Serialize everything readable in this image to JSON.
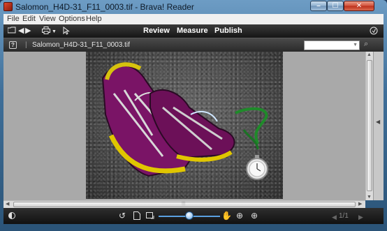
{
  "window": {
    "title": "Salomon_H4D-31_F11_0003.tif - Brava! Reader",
    "controls": {
      "minimize": "–",
      "maximize": "☐",
      "close": "✕"
    }
  },
  "menubar": {
    "items": [
      "File",
      "Edit",
      "View",
      "Options",
      "Help"
    ]
  },
  "toolbar": {
    "menus": [
      "Review",
      "Measure",
      "Publish"
    ],
    "icons": [
      "folder-icon",
      "back-icon",
      "forward-icon",
      "print-icon",
      "dropdown-icon",
      "pointer-icon",
      "globe-icon"
    ]
  },
  "tabbar": {
    "help_glyph": "?",
    "separator": "|",
    "document_tab": "Salomon_H4D-31_F11_0003.tif",
    "search_value": ""
  },
  "bottombar": {
    "page_info": "1/1",
    "zoom_level": 0.5
  },
  "colors": {
    "accent": "#5aa0e0",
    "toolbar_bg": "#1f1f1f",
    "canvas_bg": "#a9a9a9"
  }
}
